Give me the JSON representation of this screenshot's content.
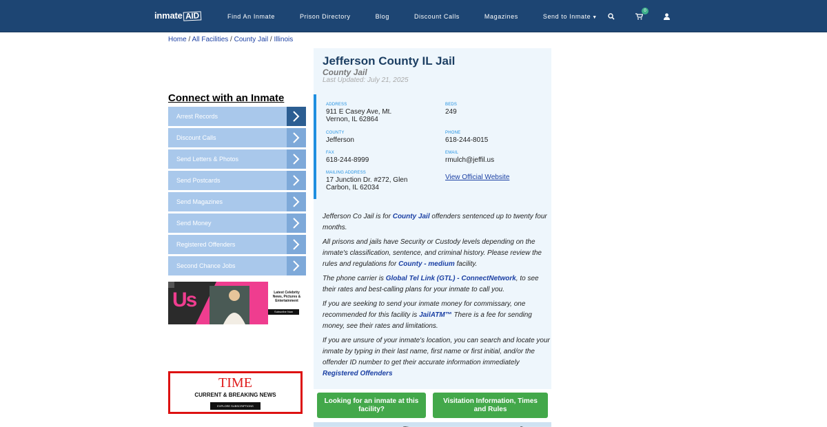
{
  "nav": {
    "logo_a": "inmate",
    "logo_b": "AID",
    "links": [
      "Find An Inmate",
      "Prison Directory",
      "Blog",
      "Discount Calls",
      "Magazines",
      "Send to Inmate"
    ],
    "cart_count": "0",
    "icons": [
      "search-icon",
      "cart-icon",
      "user-icon"
    ]
  },
  "breadcrumb": [
    "Home",
    "All Facilities",
    "County Jail",
    "Illinois"
  ],
  "sidebar": {
    "title": "Connect with an Inmate",
    "items": [
      "Arrest Records",
      "Discount Calls",
      "Send Letters & Photos",
      "Send Postcards",
      "Send Magazines",
      "Send Money",
      "Registered Offenders",
      "Second Chance Jobs"
    ]
  },
  "ads": {
    "us_logo": "Us",
    "us_text": "Latest Celebrity News, Pictures & Entertainment",
    "us_button": "Subscribe Now",
    "time_logo": "TIME",
    "time_text": "CURRENT & BREAKING NEWS",
    "time_button": "EXPLORE SUBSCRIPTIONS"
  },
  "facility": {
    "name": "Jefferson County IL Jail",
    "type": "County Jail",
    "updated": "Last Updated: July 21, 2025",
    "address_label": "ADDRESS",
    "address": "911 E Casey Ave, Mt. Vernon, IL 62864",
    "beds_label": "BEDS",
    "beds": "249",
    "county_label": "COUNTY",
    "county": "Jefferson",
    "phone_label": "PHONE",
    "phone": "618-244-8015",
    "fax_label": "FAX",
    "fax": "618-244-8999",
    "email_label": "EMAIL",
    "email": "rmulch@jeffil.us",
    "mailing_label": "MAILING ADDRESS",
    "mailing": "17 Junction Dr. #272, Glen Carbon, IL 62034",
    "website": "View Official Website"
  },
  "description": {
    "p1a": "Jefferson Co Jail is for ",
    "p1b": "County Jail",
    "p1c": " offenders sentenced up to twenty four months.",
    "p2a": "All prisons and jails have Security or Custody levels depending on the inmate's classification, sentence, and criminal history. Please review the rules and regulations for ",
    "p2b": "County - medium",
    "p2c": " facility.",
    "p3a": "The phone carrier is ",
    "p3b": "Global Tel Link (GTL) - ConnectNetwork",
    "p3c": ", to see their rates and best-calling plans for your inmate to call you.",
    "p4a": "If you are seeking to send your inmate money for commissary, one recommended for this facility is ",
    "p4b": "JailATM™",
    "p4c": " There is a fee for sending money, see their rates and limitations.",
    "p5a": "If you are unsure of your inmate's location, you can search and locate your inmate by typing in their last name, first name or first initial, and/or the offender ID number to get their accurate information immediately ",
    "p5b": "Registered Offenders"
  },
  "buttons": {
    "lookup": "Looking for an inmate at this facility?",
    "visit": "Visitation Information, Times and Rules"
  }
}
